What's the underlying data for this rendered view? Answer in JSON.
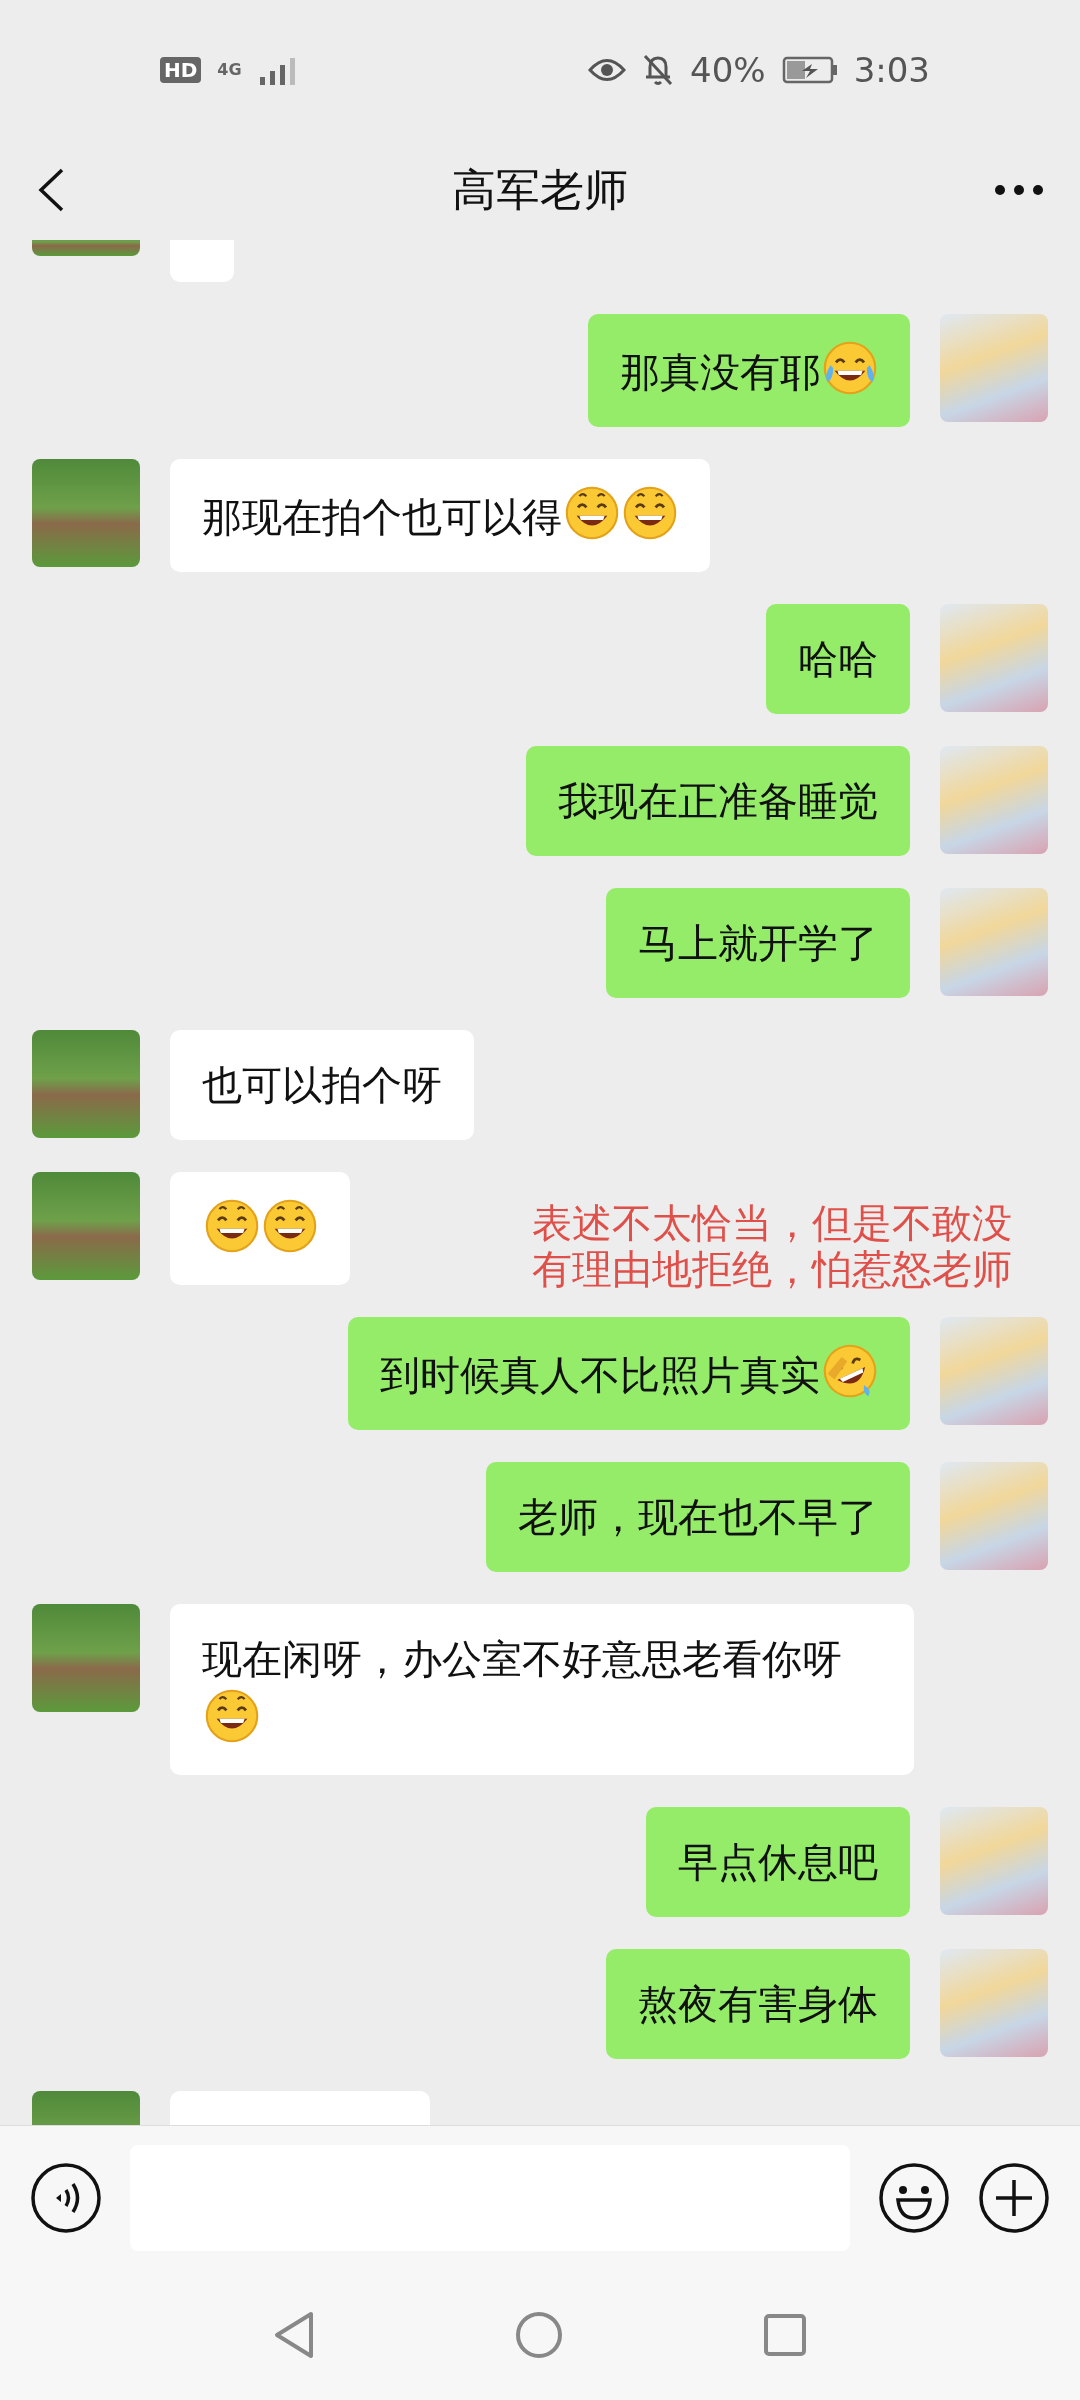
{
  "status_bar": {
    "hd_badge": "HD",
    "network": "4G",
    "battery_percent": "40%",
    "time": "3:03"
  },
  "header": {
    "title": "高军老师"
  },
  "messages": [
    {
      "kind": "received",
      "cut_off": true
    },
    {
      "kind": "sent",
      "text": "那真没有耶",
      "emojis": [
        {
          "kind": "tears-of-joy"
        }
      ]
    },
    {
      "kind": "received",
      "text": "那现在拍个也可以得",
      "emojis": [
        {
          "kind": "grin"
        },
        {
          "kind": "grin"
        }
      ]
    },
    {
      "kind": "sent",
      "text": "哈哈"
    },
    {
      "kind": "sent",
      "text": "我现在正准备睡觉"
    },
    {
      "kind": "sent",
      "text": "马上就开学了"
    },
    {
      "kind": "received",
      "text": "也可以拍个呀"
    },
    {
      "kind": "received",
      "emojis": [
        {
          "kind": "grin"
        },
        {
          "kind": "grin"
        }
      ],
      "annotation": "表述不太恰当，但是不敢没有理由地拒绝，怕惹怒老师"
    },
    {
      "kind": "sent",
      "text": "到时候真人不比照片真实",
      "emojis": [
        {
          "kind": "rolling-laugh"
        }
      ]
    },
    {
      "kind": "sent",
      "text": "老师，现在也不早了"
    },
    {
      "kind": "received",
      "text": "现在闲呀，办公室不好意思老看你呀",
      "emojis": [
        {
          "kind": "grin"
        }
      ]
    },
    {
      "kind": "sent",
      "text": "早点休息吧"
    },
    {
      "kind": "sent",
      "text": "熬夜有害身体"
    },
    {
      "kind": "received",
      "cut_off": true
    }
  ]
}
